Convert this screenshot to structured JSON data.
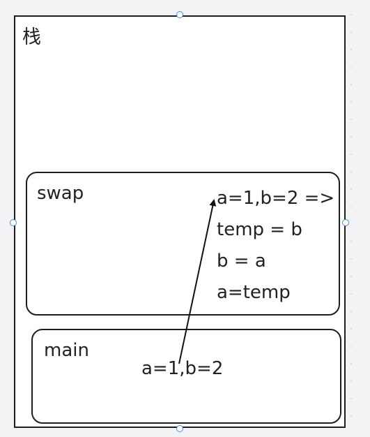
{
  "diagram": {
    "stack_title": "栈",
    "swap_frame": {
      "label": "swap",
      "code_lines": [
        "a=1,b=2 =>",
        "temp = b",
        "b = a",
        "a=temp"
      ]
    },
    "main_frame": {
      "label": "main",
      "text": "a=1,b=2"
    },
    "arrow": {
      "from": "main-text",
      "to": "swap-code-line-1"
    }
  },
  "colors": {
    "background": "#f3f3f5",
    "frame_fill": "#ffffff",
    "stroke": "#1d1d1d",
    "handle": "#3a8dde"
  }
}
